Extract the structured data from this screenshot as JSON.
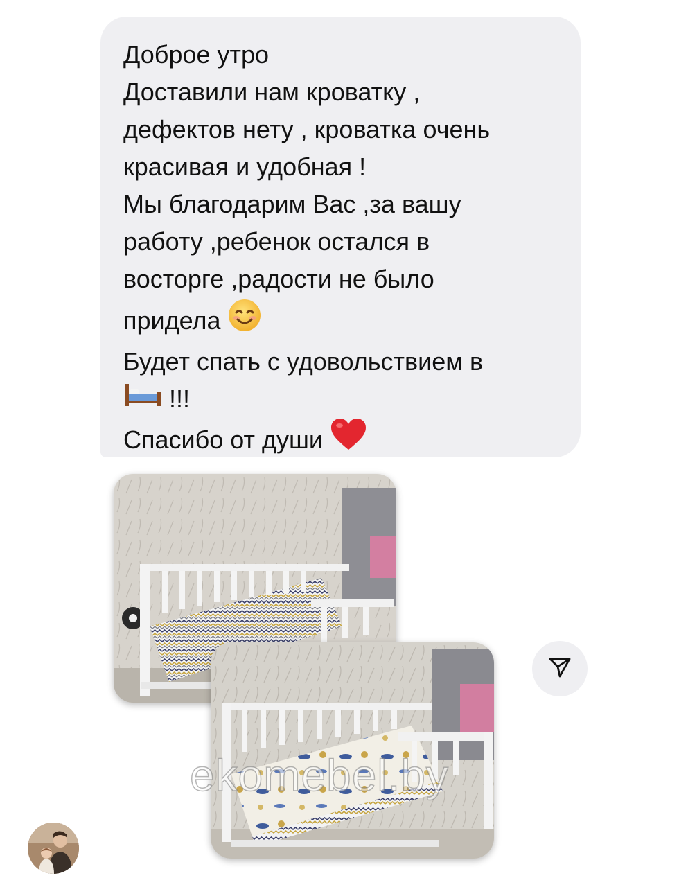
{
  "message": {
    "lines": [
      "Доброе утро",
      "Доставили нам кроватку ,",
      "дефектов нету , кроватка очень",
      "красивая и удобная !",
      "Мы благодарим Вас ,за вашу",
      "работу ,ребенок остался в",
      "восторге ,радости не было",
      "придела",
      "Будет спать с удовольствием  в",
      "!!!",
      "Спасибо от души"
    ],
    "emojis": {
      "line8": "smiling-face-emoji",
      "line10": "bed-emoji",
      "line11": "red-heart-emoji"
    }
  },
  "photos": [
    {
      "name": "crib-photo-1"
    },
    {
      "name": "crib-photo-2"
    }
  ],
  "watermark": "ekomebel.by",
  "share": {
    "icon": "send-icon"
  },
  "avatar": {
    "icon": "user-avatar"
  },
  "colors": {
    "bubble": "#efeff2",
    "text": "#111111",
    "heart": "#e3262f",
    "smile": "#f7c43c"
  }
}
